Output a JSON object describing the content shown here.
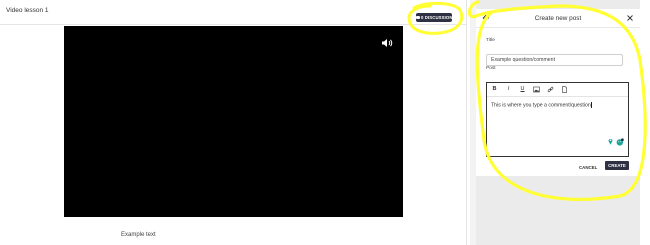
{
  "lesson": {
    "title": "Video lesson 1",
    "discussions_label": "0 DISCUSSIONS",
    "example_text": "Example text",
    "icons": {
      "volume": "volume-icon",
      "more": "more-dots-icon"
    }
  },
  "drawer": {
    "title": "Create new post",
    "title_label": "Title",
    "title_value": "Example question/comment",
    "post_label": "Post",
    "post_text": "This is where you type a comment/question",
    "toolbar": [
      "B",
      "I",
      "U",
      "image-icon",
      "link-icon",
      "file-icon"
    ],
    "cancel_label": "CANCEL",
    "create_label": "CREATE"
  },
  "colors": {
    "primary_button": "#2d3142",
    "annotation": "#ffff33",
    "accent": "#1aa39a"
  }
}
